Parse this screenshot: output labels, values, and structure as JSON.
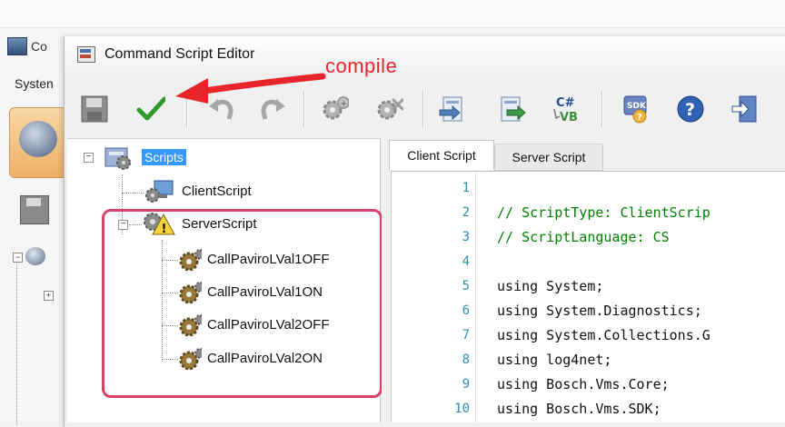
{
  "background_app": {
    "title_partial": "Co",
    "menu_partial": "Systen"
  },
  "window": {
    "title": "Command Script Editor"
  },
  "annotation": {
    "label": "compile",
    "color": "#e8252a"
  },
  "toolbar": {
    "buttons": [
      {
        "icon": "save-icon"
      },
      {
        "icon": "compile-checkmark-icon"
      },
      {
        "icon": "undo-icon"
      },
      {
        "icon": "redo-icon"
      },
      {
        "icon": "add-script-gear-icon"
      },
      {
        "icon": "remove-script-gear-icon"
      },
      {
        "icon": "import-icon"
      },
      {
        "icon": "export-icon"
      },
      {
        "icon": "csharp-vb-icon",
        "text_top": "C#",
        "text_bottom": "VB"
      },
      {
        "icon": "sdk-help-icon",
        "text": "SDK"
      },
      {
        "icon": "help-icon",
        "text": "?"
      },
      {
        "icon": "exit-icon"
      }
    ]
  },
  "tree": {
    "root": "Scripts",
    "client": "ClientScript",
    "server": "ServerScript",
    "server_items": [
      "CallPaviroLVal1OFF",
      "CallPaviroLVal1ON",
      "CallPaviroLVal2OFF",
      "CallPaviroLVal2ON"
    ]
  },
  "tabs": {
    "client": "Client Script",
    "server": "Server Script",
    "active": "client"
  },
  "code": {
    "line_numbers": [
      "1",
      "2",
      "3",
      "4",
      "5",
      "6",
      "7",
      "8",
      "9",
      "10"
    ],
    "lines": [
      "",
      "// ScriptType: ClientScrip",
      "// ScriptLanguage: CS",
      "",
      "using System;",
      "using System.Diagnostics;",
      "using System.Collections.G",
      "using log4net;",
      "using Bosch.Vms.Core;",
      "using Bosch.Vms.SDK;"
    ]
  }
}
